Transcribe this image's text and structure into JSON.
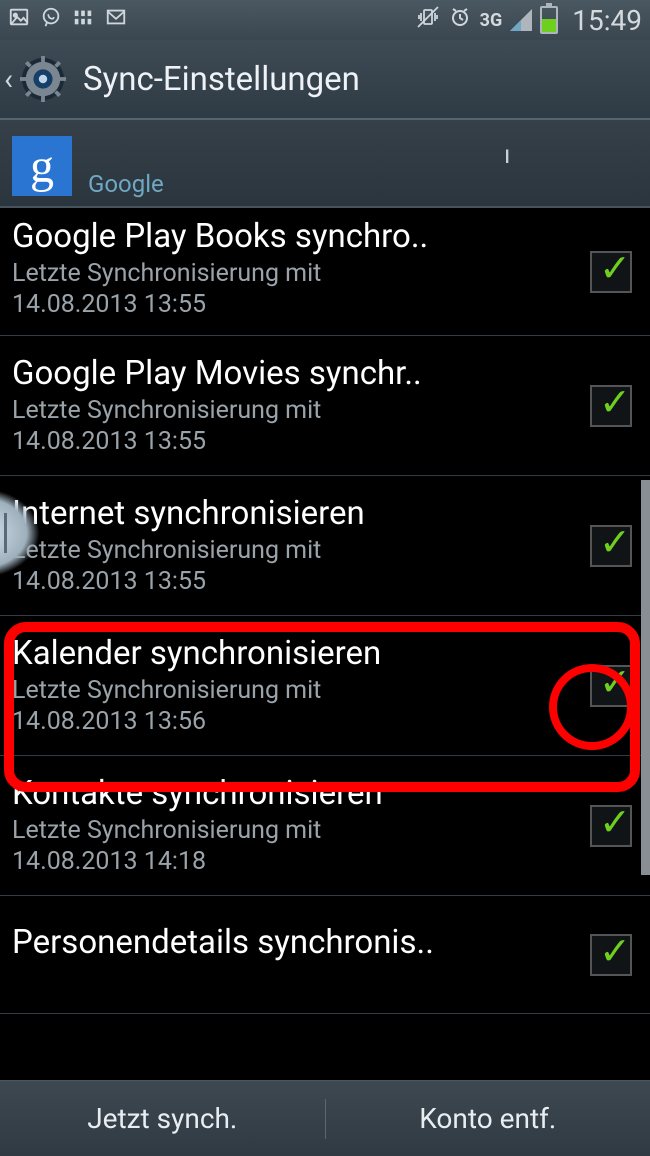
{
  "status": {
    "network_label": "3G",
    "time": "15:49"
  },
  "title_bar": {
    "title": "Sync-Einstellungen"
  },
  "account": {
    "badge_letter": "g",
    "obscured_tail": "ı",
    "provider": "Google"
  },
  "items": [
    {
      "title": "Google Play Books synchro..",
      "sub1": "Letzte Synchronisierung mit",
      "sub2": "14.08.2013 13:55",
      "checked": true
    },
    {
      "title": "Google Play Movies synchr..",
      "sub1": "Letzte Synchronisierung mit",
      "sub2": "14.08.2013 13:55",
      "checked": true
    },
    {
      "title": "Internet synchronisieren",
      "sub1": "Letzte Synchronisierung mit",
      "sub2": "14.08.2013 13:55",
      "checked": true
    },
    {
      "title": "Kalender synchronisieren",
      "sub1": "Letzte Synchronisierung mit",
      "sub2": "14.08.2013 13:56",
      "checked": true
    },
    {
      "title": "Kontakte synchronisieren",
      "sub1": "Letzte Synchronisierung mit",
      "sub2": "14.08.2013 14:18",
      "checked": true
    },
    {
      "title": "Personendetails synchronis..",
      "sub1": "",
      "sub2": "",
      "checked": true
    }
  ],
  "bottom": {
    "sync_now": "Jetzt synch.",
    "remove_account": "Konto entf."
  }
}
